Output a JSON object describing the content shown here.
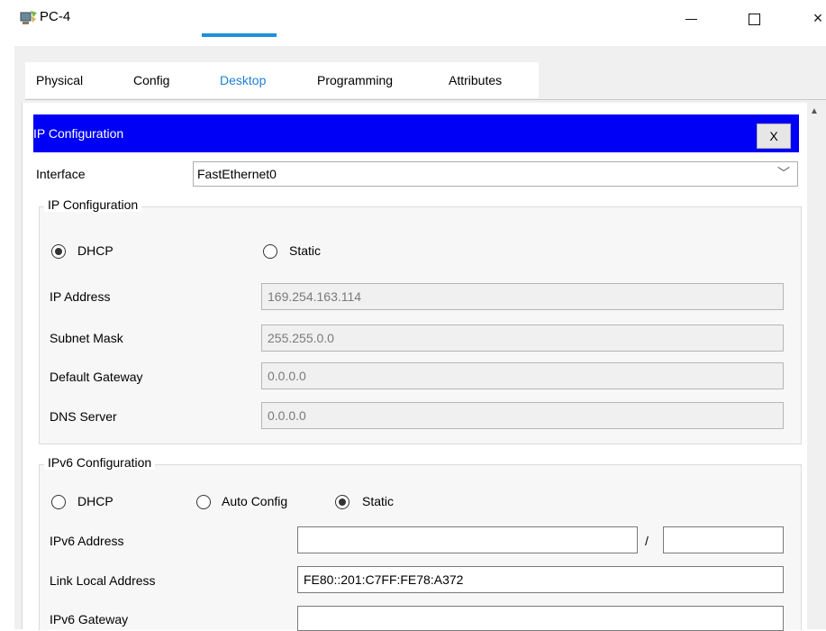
{
  "window": {
    "title": "PC-4",
    "minimize": "—",
    "maximize": "□",
    "close": "×"
  },
  "tabs": [
    {
      "label": "Physical"
    },
    {
      "label": "Config"
    },
    {
      "label": "Desktop"
    },
    {
      "label": "Programming"
    },
    {
      "label": "Attributes"
    }
  ],
  "ip_config": {
    "header": "IP Configuration",
    "close_label": "X",
    "interface_label": "Interface",
    "interface_value": "FastEthernet0",
    "ipv4": {
      "legend": "IP Configuration",
      "dhcp_label": "DHCP",
      "static_label": "Static",
      "mode": "DHCP",
      "ip_address_label": "IP Address",
      "ip_address": "169.254.163.114",
      "subnet_mask_label": "Subnet Mask",
      "subnet_mask": "255.255.0.0",
      "default_gateway_label": "Default Gateway",
      "default_gateway": "0.0.0.0",
      "dns_server_label": "DNS Server",
      "dns_server": "0.0.0.0"
    },
    "ipv6": {
      "legend": "IPv6 Configuration",
      "dhcp_label": "DHCP",
      "auto_config_label": "Auto Config",
      "static_label": "Static",
      "mode": "Static",
      "ipv6_address_label": "IPv6 Address",
      "ipv6_address": "",
      "slash": "/",
      "prefix_length": "",
      "link_local_label": "Link Local Address",
      "link_local_address": "FE80::201:C7FF:FE78:A372",
      "ipv6_gateway_label": "IPv6 Gateway",
      "ipv6_gateway": ""
    }
  },
  "colors": {
    "header_bg": "#0000f7",
    "active_tab": "#1e90d8"
  }
}
